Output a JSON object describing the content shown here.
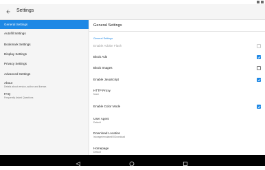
{
  "appbar": {
    "title": "Settings",
    "back_icon": "arrow-back-icon"
  },
  "nav": {
    "items": [
      {
        "label": "General Settings",
        "selected": true
      },
      {
        "label": "Autofill Settings"
      },
      {
        "label": "Bookmark Settings"
      },
      {
        "label": "Display Settings"
      },
      {
        "label": "Privacy Settings"
      },
      {
        "label": "Advanced Settings"
      },
      {
        "label": "About",
        "sub": "Details about version, author and license."
      },
      {
        "label": "FAQ",
        "sub": "Frequently Asked Questions"
      }
    ]
  },
  "pane": {
    "title": "General Settings",
    "category": "General Settings",
    "rows": [
      {
        "label": "Enable Adobe Flash",
        "disabled": true,
        "checkbox": false
      },
      {
        "label": "Block Ads",
        "checkbox": true
      },
      {
        "label": "Block Images",
        "checkbox": false
      },
      {
        "label": "Enable JavaScript",
        "checkbox": true
      },
      {
        "label": "HTTP Proxy",
        "sub": "None"
      },
      {
        "label": "Enable Color Mode",
        "checkbox": true
      },
      {
        "label": "User Agent",
        "sub": "Default"
      },
      {
        "label": "Download Location",
        "sub": "/storage/emulated/0/Download"
      },
      {
        "label": "Homepage",
        "sub": "Default"
      }
    ]
  },
  "system_nav": {
    "icons": [
      "back-triangle-icon",
      "home-circle-icon",
      "recents-square-icon"
    ]
  },
  "colors": {
    "accent": "#1e88e5",
    "navbar": "#000000",
    "sidebar_bg": "#f5f5f5"
  }
}
